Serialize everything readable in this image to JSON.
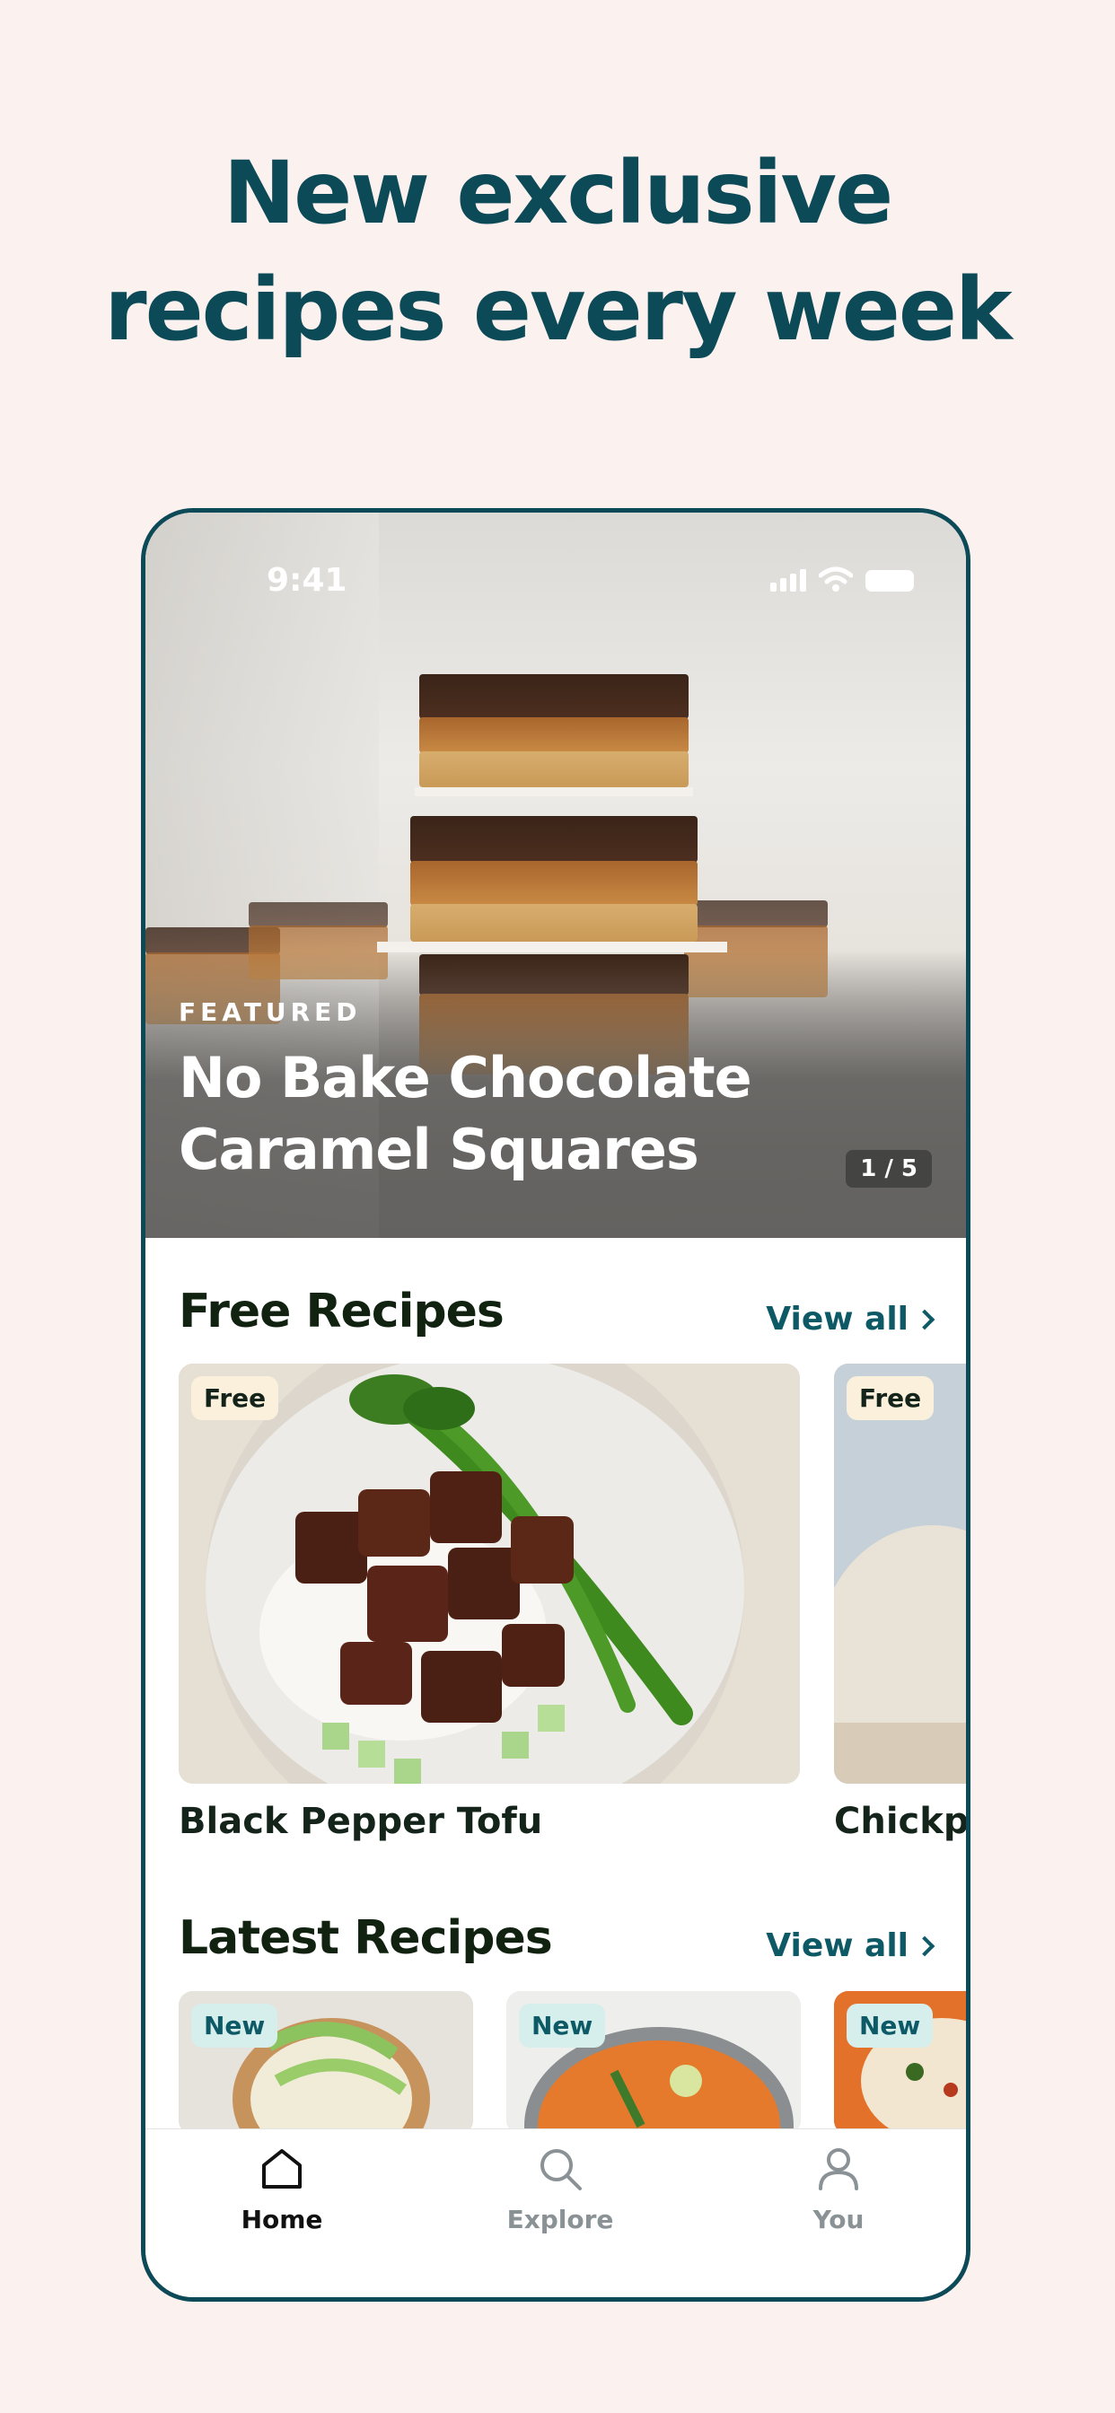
{
  "headline": {
    "line1": "New exclusive",
    "line2": "recipes every week"
  },
  "status_bar": {
    "time": "9:41"
  },
  "featured": {
    "label": "FEATURED",
    "title_line1": "No Bake Chocolate",
    "title_line2": "Caramel Squares",
    "counter": "1 / 5"
  },
  "free_recipes": {
    "title": "Free Recipes",
    "view_all": "View all",
    "cards": [
      {
        "badge": "Free",
        "title": "Black Pepper Tofu"
      },
      {
        "badge": "Free",
        "title": "Chickpe"
      }
    ]
  },
  "latest_recipes": {
    "title": "Latest Recipes",
    "view_all": "View all",
    "cards": [
      {
        "badge": "New"
      },
      {
        "badge": "New"
      },
      {
        "badge": "New"
      }
    ]
  },
  "tabbar": {
    "tabs": [
      {
        "label": "Home",
        "icon": "home-icon",
        "active": true
      },
      {
        "label": "Explore",
        "icon": "search-icon",
        "active": false
      },
      {
        "label": "You",
        "icon": "user-icon",
        "active": false
      }
    ]
  },
  "colors": {
    "brand": "#0d4a57",
    "link": "#0d5a66",
    "background": "#fbf1ef"
  }
}
